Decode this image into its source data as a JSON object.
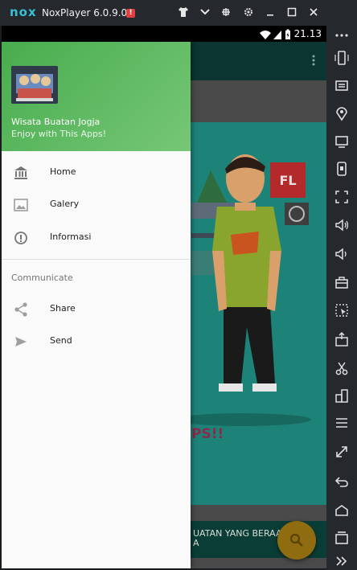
{
  "emulator": {
    "logo": "nox",
    "title": "NoxPlayer 6.0.9.0",
    "alert_badge": "!",
    "titlebar_icons": [
      "shirt-icon",
      "chevron-down-icon",
      "pin-icon",
      "gear-icon",
      "minimize-icon",
      "maximize-icon",
      "close-icon"
    ]
  },
  "statusbar": {
    "time": "21.13",
    "icons": [
      "wifi-icon",
      "signal-icon",
      "battery-icon"
    ]
  },
  "app": {
    "banner_text_line1": "UATAN YANG BERAA",
    "banner_text_line2": "A",
    "fab_icon": "search-icon"
  },
  "drawer": {
    "header": {
      "app_name": "Wisata Buatan Jogja",
      "subtitle": "Enjoy with This Apps!"
    },
    "items": [
      {
        "label": "Home",
        "icon": "bank-icon"
      },
      {
        "label": "Galery",
        "icon": "image-icon"
      },
      {
        "label": "Informasi",
        "icon": "info-icon"
      }
    ],
    "section_title": "Communicate",
    "section_items": [
      {
        "label": "Share",
        "icon": "share-icon"
      },
      {
        "label": "Send",
        "icon": "send-icon"
      }
    ]
  },
  "side_toolbar": {
    "icons": [
      "more-icon",
      "rotate-icon",
      "keyboard-icon",
      "location-icon",
      "screen-icon",
      "screenshot-icon",
      "fullscreen-icon",
      "volume-up-icon",
      "volume-down-icon",
      "toolbox-icon",
      "macro-icon",
      "apk-icon",
      "scissors-icon",
      "multi-instance-icon",
      "menu-icon",
      "resize-icon",
      "back-icon",
      "home-icon",
      "recent-apps-icon",
      "expand-icon"
    ]
  },
  "colors": {
    "drawer_header_start": "#48ac4e",
    "drawer_header_end": "#76c776",
    "app_teal": "#1d8379",
    "fab": "#8e6c0f",
    "emulator_chrome": "#25282d"
  }
}
